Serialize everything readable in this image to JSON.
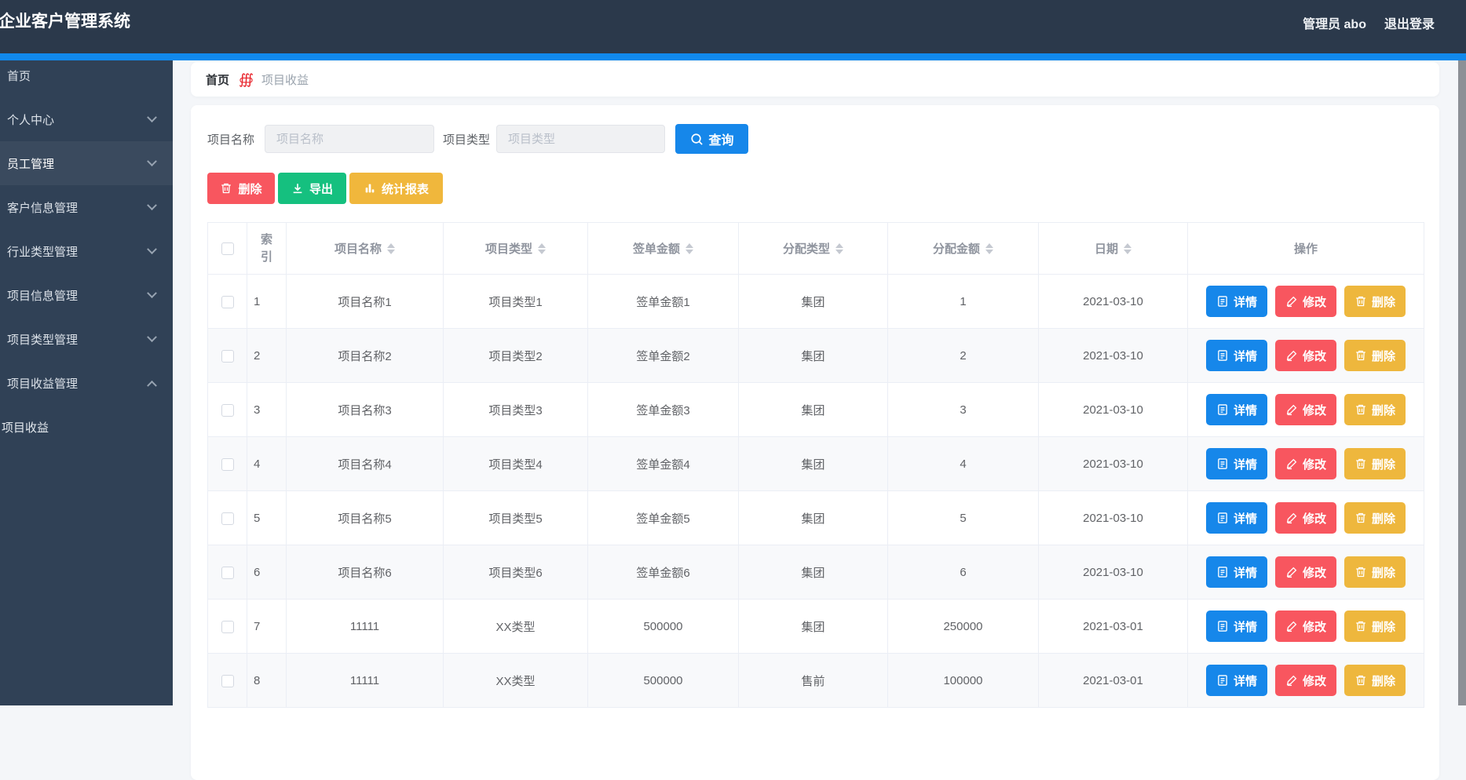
{
  "app": {
    "title": "企业客户管理系统",
    "admin_label": "管理员 abo",
    "logout_label": "退出登录"
  },
  "palette": {
    "topbar_bg": "#2b394b",
    "sidebar_bg": "#304156",
    "sidebar_active_bg": "#3a4a5e",
    "accent_strip": "#1189ec",
    "primary_blue": "#1687ea",
    "danger_red": "#f8565f",
    "success_green": "#15c07f",
    "warning_yellow": "#f0b73c",
    "page_bg": "#f4f6f9"
  },
  "sidebar": {
    "items": [
      {
        "label": "首页",
        "arrow": "none",
        "active": false
      },
      {
        "label": "个人中心",
        "arrow": "down",
        "active": false
      },
      {
        "label": "员工管理",
        "arrow": "down",
        "active": true
      },
      {
        "label": "客户信息管理",
        "arrow": "down",
        "active": false
      },
      {
        "label": "行业类型管理",
        "arrow": "down",
        "active": false
      },
      {
        "label": "项目信息管理",
        "arrow": "down",
        "active": false
      },
      {
        "label": "项目类型管理",
        "arrow": "down",
        "active": false
      },
      {
        "label": "项目收益管理",
        "arrow": "up",
        "active": false
      }
    ],
    "sub_items": [
      {
        "label": "项目收益"
      }
    ]
  },
  "breadcrumb": {
    "home": "首页",
    "separator": "∰",
    "separator_icon": "red-integral-icon",
    "current": "项目收益"
  },
  "search": {
    "name_label": "项目名称",
    "name_placeholder": "项目名称",
    "type_label": "项目类型",
    "type_placeholder": "项目类型",
    "submit_label": "查询",
    "submit_icon": "search-icon"
  },
  "toolbar": {
    "delete_label": "删除",
    "delete_icon": "trash-icon",
    "export_label": "导出",
    "export_icon": "download-icon",
    "report_label": "统计报表",
    "report_icon": "bar-chart-icon"
  },
  "table": {
    "columns": [
      {
        "label": "",
        "type": "checkbox",
        "sortable": false
      },
      {
        "label": "索引",
        "type": "narrow",
        "sortable": false
      },
      {
        "label": "项目名称",
        "sortable": true
      },
      {
        "label": "项目类型",
        "sortable": true
      },
      {
        "label": "签单金额",
        "sortable": true
      },
      {
        "label": "分配类型",
        "sortable": true
      },
      {
        "label": "分配金额",
        "sortable": true
      },
      {
        "label": "日期",
        "sortable": true
      },
      {
        "label": "操作",
        "sortable": false
      }
    ],
    "rows": [
      {
        "index": "1",
        "name": "项目名称1",
        "type": "项目类型1",
        "amount": "签单金额1",
        "alloc_type": "集团",
        "alloc_amount": "1",
        "date": "2021-03-10"
      },
      {
        "index": "2",
        "name": "项目名称2",
        "type": "项目类型2",
        "amount": "签单金额2",
        "alloc_type": "集团",
        "alloc_amount": "2",
        "date": "2021-03-10"
      },
      {
        "index": "3",
        "name": "项目名称3",
        "type": "项目类型3",
        "amount": "签单金额3",
        "alloc_type": "集团",
        "alloc_amount": "3",
        "date": "2021-03-10"
      },
      {
        "index": "4",
        "name": "项目名称4",
        "type": "项目类型4",
        "amount": "签单金额4",
        "alloc_type": "集团",
        "alloc_amount": "4",
        "date": "2021-03-10"
      },
      {
        "index": "5",
        "name": "项目名称5",
        "type": "项目类型5",
        "amount": "签单金额5",
        "alloc_type": "集团",
        "alloc_amount": "5",
        "date": "2021-03-10"
      },
      {
        "index": "6",
        "name": "项目名称6",
        "type": "项目类型6",
        "amount": "签单金额6",
        "alloc_type": "集团",
        "alloc_amount": "6",
        "date": "2021-03-10"
      },
      {
        "index": "7",
        "name": "11111",
        "type": "XX类型",
        "amount": "500000",
        "alloc_type": "集团",
        "alloc_amount": "250000",
        "date": "2021-03-01"
      },
      {
        "index": "8",
        "name": "11111",
        "type": "XX类型",
        "amount": "500000",
        "alloc_type": "售前",
        "alloc_amount": "100000",
        "date": "2021-03-01"
      }
    ],
    "row_actions": [
      {
        "label": "详情",
        "icon": "document-icon",
        "class": "detail"
      },
      {
        "label": "修改",
        "icon": "pencil-icon",
        "class": "edit"
      },
      {
        "label": "删除",
        "icon": "trash-icon",
        "class": "remove"
      }
    ]
  }
}
